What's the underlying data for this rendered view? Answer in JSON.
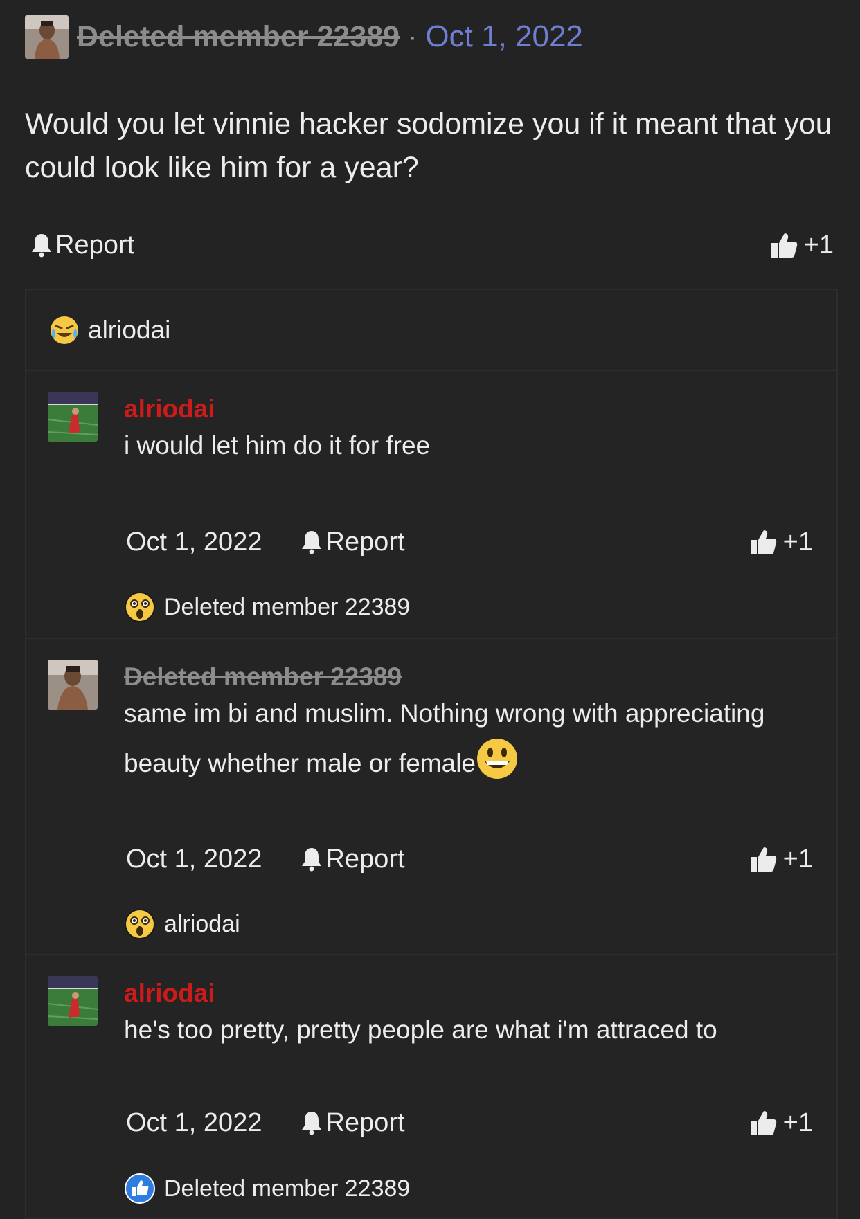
{
  "post": {
    "author": "Deleted member 22389",
    "separator": "·",
    "date": "Oct 1, 2022",
    "body": "Would you let vinnie hacker sodomize you if it meant that you could look like him for a year?",
    "report_label": "Report",
    "like_count": "+1",
    "avatar_icon": "user-photo-avatar"
  },
  "reaction_summary": {
    "icon": "laughing-crying-emoji",
    "user": "alriodai"
  },
  "comments": [
    {
      "author": "alriodai",
      "author_deleted": false,
      "text": "i would let him do it for free",
      "date": "Oct 1, 2022",
      "report_label": "Report",
      "like_count": "+1",
      "reaction_icon": "astonished-emoji",
      "reaction_user": "Deleted member 22389"
    },
    {
      "author": "Deleted member 22389",
      "author_deleted": true,
      "text": "same im bi and muslim. Nothing wrong with appreciating beauty whether male or female",
      "text_emoji": "grinning-emoji",
      "date": "Oct 1, 2022",
      "report_label": "Report",
      "like_count": "+1",
      "reaction_icon": "astonished-emoji",
      "reaction_user": "alriodai"
    },
    {
      "author": "alriodai",
      "author_deleted": false,
      "text": "he's too pretty, pretty people are what i'm attraced to",
      "date": "Oct 1, 2022",
      "report_label": "Report",
      "like_count": "+1",
      "reaction_icon": "like-emoji",
      "reaction_user": "Deleted member 22389"
    }
  ],
  "colors": {
    "background": "#232324",
    "link_blue": "#6f7ed2",
    "author_red": "#cc1b1b",
    "deleted_gray": "#8c8c8c"
  }
}
